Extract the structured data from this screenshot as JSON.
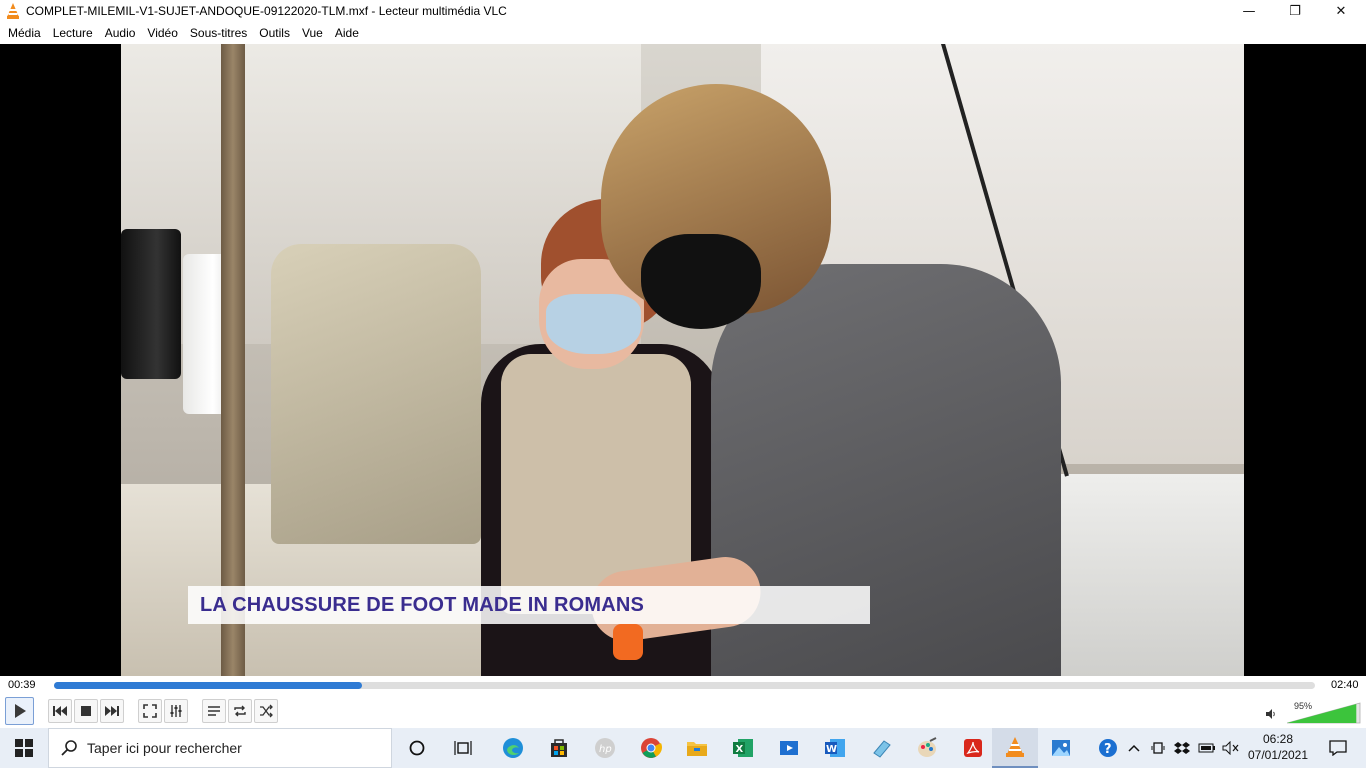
{
  "window": {
    "title": "COMPLET-MILEMIL-V1-SUJET-ANDOQUE-09122020-TLM.mxf - Lecteur multimédia VLC",
    "controls": {
      "minimize": "—",
      "maximize": "❐",
      "close": "✕"
    }
  },
  "menu": [
    {
      "label": "Média"
    },
    {
      "label": "Lecture"
    },
    {
      "label": "Audio"
    },
    {
      "label": "Vidéo"
    },
    {
      "label": "Sous-titres"
    },
    {
      "label": "Outils"
    },
    {
      "label": "Vue"
    },
    {
      "label": "Aide"
    }
  ],
  "video": {
    "caption": "LA CHAUSSURE DE FOOT MADE IN ROMANS"
  },
  "playback": {
    "elapsed": "00:39",
    "total": "02:40",
    "progress": 0.244
  },
  "volume": {
    "label": "95%",
    "level": 0.95
  },
  "taskbar": {
    "search_placeholder": "Taper ici pour rechercher",
    "time": "06:28",
    "date": "07/01/2021",
    "apps": [
      "cortana-icon",
      "task-view-icon",
      "edge-icon",
      "store-icon",
      "hp-icon",
      "chrome-icon",
      "file-explorer-icon",
      "excel-icon",
      "media-player-icon",
      "word-icon",
      "tablet-app-icon",
      "paint-icon",
      "acrobat-icon",
      "vlc-icon",
      "photos-icon"
    ]
  },
  "colors": {
    "accent": "#2f7bd4",
    "caption_text": "#3a2d8f",
    "vlc_orange": "#f28c1e"
  }
}
